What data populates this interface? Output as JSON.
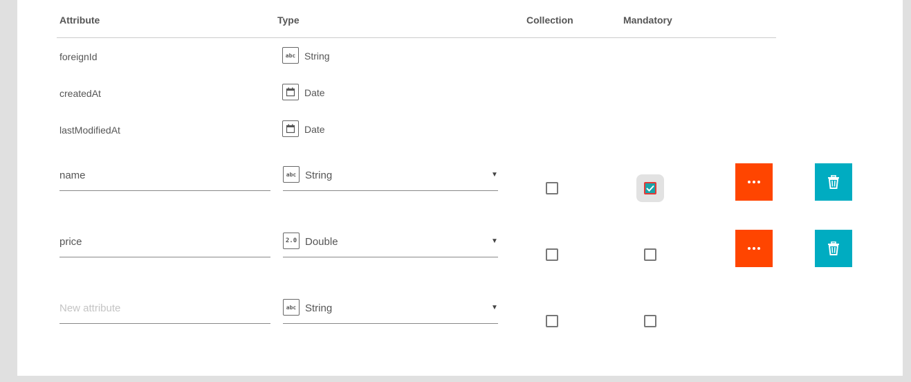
{
  "headers": {
    "attribute": "Attribute",
    "type": "Type",
    "collection": "Collection",
    "mandatory": "Mandatory"
  },
  "readonly_rows": [
    {
      "name": "foreignId",
      "type": "String",
      "icon": "abc-icon"
    },
    {
      "name": "createdAt",
      "type": "Date",
      "icon": "calendar-icon"
    },
    {
      "name": "lastModifiedAt",
      "type": "Date",
      "icon": "calendar-icon"
    }
  ],
  "editable_rows": [
    {
      "name": "name",
      "type": "String",
      "type_icon_text": "abc",
      "collection": false,
      "mandatory": true
    },
    {
      "name": "price",
      "type": "Double",
      "type_icon_text": "2.0",
      "collection": false,
      "mandatory": false
    }
  ],
  "new_row": {
    "placeholder": "New attribute",
    "type": "String",
    "type_icon_text": "abc",
    "collection": false,
    "mandatory": false
  },
  "icons": {
    "abc": "abc",
    "double": "2.0",
    "dropdown": "▼"
  },
  "colors": {
    "more_button": "#ff4500",
    "delete_button": "#00acc1",
    "checked_fill": "#1aa3a8",
    "checked_border": "#e53935"
  }
}
